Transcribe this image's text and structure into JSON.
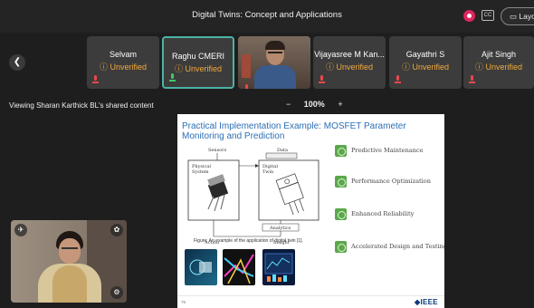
{
  "meeting": {
    "title": "Digital Twins: Concept and Applications",
    "cc_label": "CC",
    "layout_label": "Layout"
  },
  "participants": [
    {
      "name": "Selvam",
      "status": "Unverified"
    },
    {
      "name": "Raghu CMERI",
      "status": "Unverified"
    },
    {
      "name": "Vijayasree M Kan...",
      "status": "Unverified"
    },
    {
      "name": "Gayathri S",
      "status": "Unverified"
    },
    {
      "name": "Ajit Singh",
      "status": "Unverified"
    }
  ],
  "sharing": {
    "viewing_text": "Viewing Sharan Karthick BL's shared content",
    "zoom_minus": "−",
    "zoom_level": "100%",
    "zoom_plus": "+"
  },
  "slide": {
    "title": "Practical Implementation Example: MOSFET Parameter Monitoring and Prediction",
    "diagram": {
      "sensors": "Sensors",
      "data": "Data",
      "physical_system": [
        "Physical",
        "System"
      ],
      "digital_twin": [
        "Digital",
        "Twin"
      ],
      "analytics": "Analytics",
      "action": "Action",
      "insight": "Insight"
    },
    "figure_caption": "Figure: An example of the application of digital twin [1].",
    "features": [
      "Predictive Maintenance",
      "Performance Optimization",
      "Enhanced Reliability",
      "Accelerated Design and Testing"
    ],
    "slide_number": "76",
    "logo_text": "◆IEEE"
  },
  "colors": {
    "accent_teal": "#4ab3a5",
    "warning_orange": "#f2a93b",
    "mic_muted_red": "#e8484c",
    "slide_title_blue": "#2c6fb5",
    "feature_green": "#5aa84a"
  }
}
